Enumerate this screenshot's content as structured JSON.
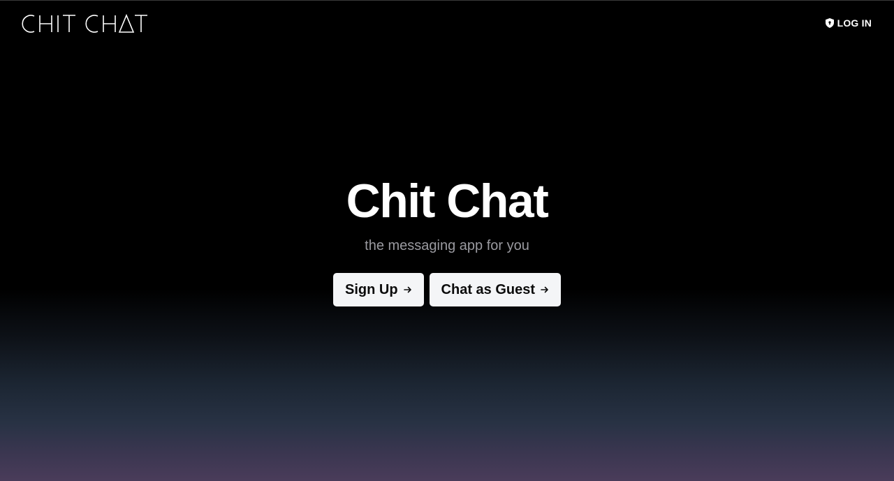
{
  "header": {
    "logo_text": "CHIT CHAT",
    "login_label": "LOG IN",
    "login_icon": "shield-icon"
  },
  "hero": {
    "title": "Chit Chat",
    "subtitle": "the messaging app for you"
  },
  "actions": {
    "signup_label": "Sign Up",
    "guest_label": "Chat as Guest",
    "arrow_icon": "arrow-right-icon"
  },
  "colors": {
    "background_top": "#000000",
    "background_bottom": "#4a3c5a",
    "button_bg": "#f4f5f7",
    "button_text": "#0b0b0b",
    "subtitle": "#9a9aa0"
  }
}
